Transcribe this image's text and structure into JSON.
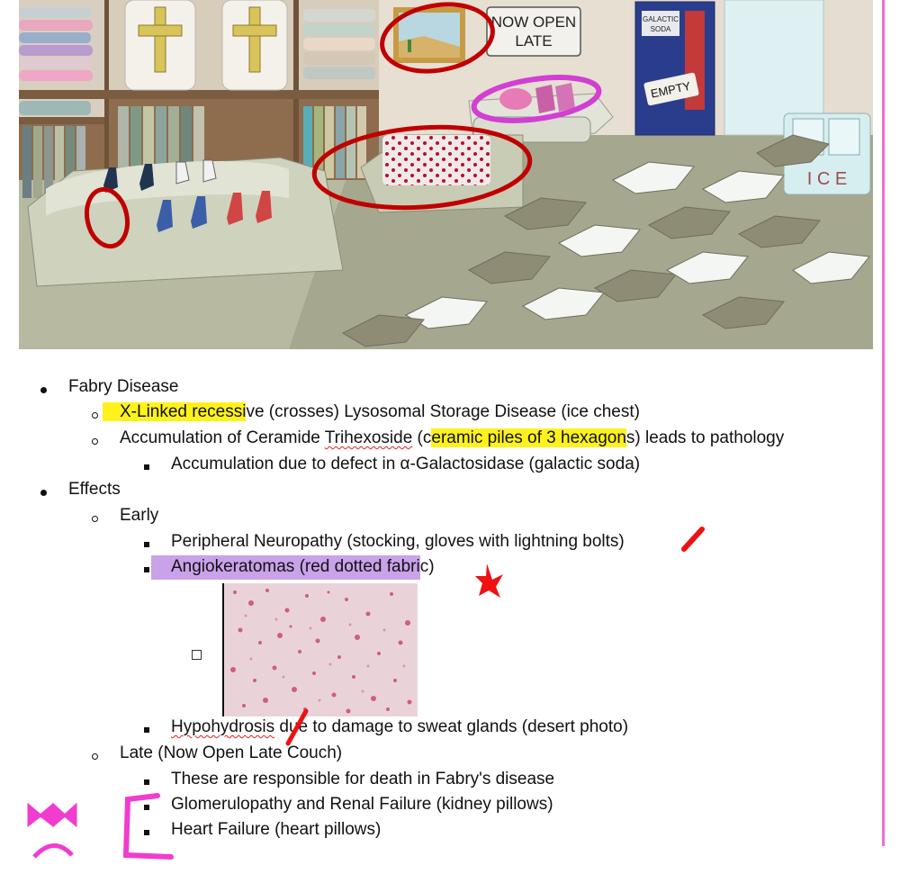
{
  "scene": {
    "signs": {
      "now_open_line1": "NOW OPEN",
      "now_open_line2": "LATE",
      "soda_line1": "GALACTIC",
      "soda_line2": "SODA",
      "empty": "EMPTY",
      "ice": "I C E"
    },
    "colors": {
      "wall": "#e3d9cb",
      "shelf_wood": "#8a6a4a",
      "floor": "#8f8f7a",
      "hexagon_light": "#f4f6f3",
      "hexagon_dark": "#8e8c74",
      "circle_red": "#c00000",
      "circle_magenta": "#d23fd2",
      "soda_machine": "#2a3d8c"
    }
  },
  "notes": {
    "fabry_title": "Fabry Disease",
    "xlinked_highlight": "X-Linked recessi",
    "xlinked_rest": "ve (crosses) Lysosomal Storage Disease (ice chest)",
    "accum_pre": "Accumulation of Ceramide ",
    "accum_squiggle": "Trihexoside",
    "accum_mid": " (c",
    "accum_highlight": "eramic piles of 3 hexagon",
    "accum_post": "s) leads to pathology",
    "defect": "Accumulation due to defect in α-Galactosidase (galactic soda)",
    "effects_title": "Effects",
    "early_title": "Early",
    "neuropathy": "Peripheral Neuropathy (stocking, gloves with lightning bolts)",
    "angio_highlight": "Angiokeratomas (red dotted fabri",
    "angio_rest": "c)",
    "hypo_squiggle": "Hypohydrosis",
    "hypo_rest": " due to damage to sweat glands (desert photo)",
    "late_title": "Late (Now Open Late Couch)",
    "death": "These are responsible for death in Fabry's disease",
    "renal": "Glomerulopathy and Renal Failure (kidney pillows)",
    "heart": "Heart Failure (heart pillows)"
  },
  "annotation_colors": {
    "highlight_yellow": "#fff21c",
    "highlight_purple": "#c9a2ea",
    "ink_red": "#ee1111",
    "ink_pink": "#f03ccf"
  }
}
